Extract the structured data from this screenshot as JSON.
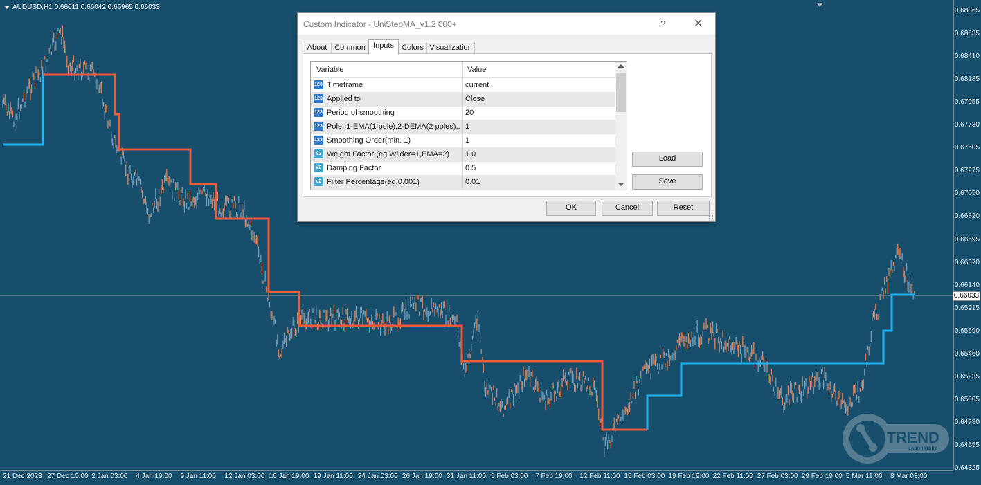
{
  "chart": {
    "symbol_info": "AUDUSD,H1  0.66011 0.66042 0.65965 0.66033",
    "current_price": "0.66033",
    "y_labels": [
      "0.68865",
      "0.68635",
      "0.68410",
      "0.68185",
      "0.67955",
      "0.67730",
      "0.67505",
      "0.67275",
      "0.67050",
      "0.66820",
      "0.66595",
      "0.66370",
      "0.66140",
      "0.65915",
      "0.65690",
      "0.65460",
      "0.65235",
      "0.65005",
      "0.64780",
      "0.64555",
      "0.64325"
    ],
    "x_labels": [
      "21 Dec 2023",
      "27 Dec 10:00",
      "2 Jan 03:00",
      "4 Jan 19:00",
      "9 Jan 11:00",
      "12 Jan 03:00",
      "16 Jan 19:00",
      "19 Jan 11:00",
      "24 Jan 03:00",
      "26 Jan 19:00",
      "31 Jan 11:00",
      "5 Feb 03:00",
      "7 Feb 19:00",
      "12 Feb 11:00",
      "15 Feb 03:00",
      "19 Feb 19:00",
      "22 Feb 11:00",
      "27 Feb 03:00",
      "29 Feb 19:00",
      "5 Mar 11:00",
      "8 Mar 03:00"
    ],
    "colors": {
      "background": "#174e6b",
      "bull_line": "#1fb3f0",
      "bear_line": "#f05a3c",
      "price_up": "#e08158",
      "price_down": "#6fa0bd"
    },
    "logo_text": "TREND",
    "logo_sub": "LABORATORY"
  },
  "dialog": {
    "title": "Custom Indicator - UniStepMA_v1.2 600+",
    "help": "?",
    "close": "✕",
    "tabs": [
      "About",
      "Common",
      "Inputs",
      "Colors",
      "Visualization"
    ],
    "active_tab": "Inputs",
    "grid_headers": {
      "variable": "Variable",
      "value": "Value"
    },
    "rows": [
      {
        "icon": "123",
        "name": "Timeframe",
        "value": "current"
      },
      {
        "icon": "123",
        "name": "Applied to",
        "value": "Close"
      },
      {
        "icon": "123",
        "name": "Period of smoothing",
        "value": "20"
      },
      {
        "icon": "123",
        "name": "Pole: 1-EMA(1 pole),2-DEMA(2 poles),...",
        "value": "1"
      },
      {
        "icon": "123",
        "name": "Smoothing Order(min. 1)",
        "value": "1"
      },
      {
        "icon": "V2",
        "name": "Weight Factor (eg.Wilder=1,EMA=2)",
        "value": "1.0"
      },
      {
        "icon": "V2",
        "name": "Damping Factor",
        "value": "0.5"
      },
      {
        "icon": "V2",
        "name": "Filter Percentage(eg.0.001)",
        "value": "0.01"
      }
    ],
    "buttons": {
      "load": "Load",
      "save": "Save",
      "ok": "OK",
      "cancel": "Cancel",
      "reset": "Reset"
    }
  }
}
